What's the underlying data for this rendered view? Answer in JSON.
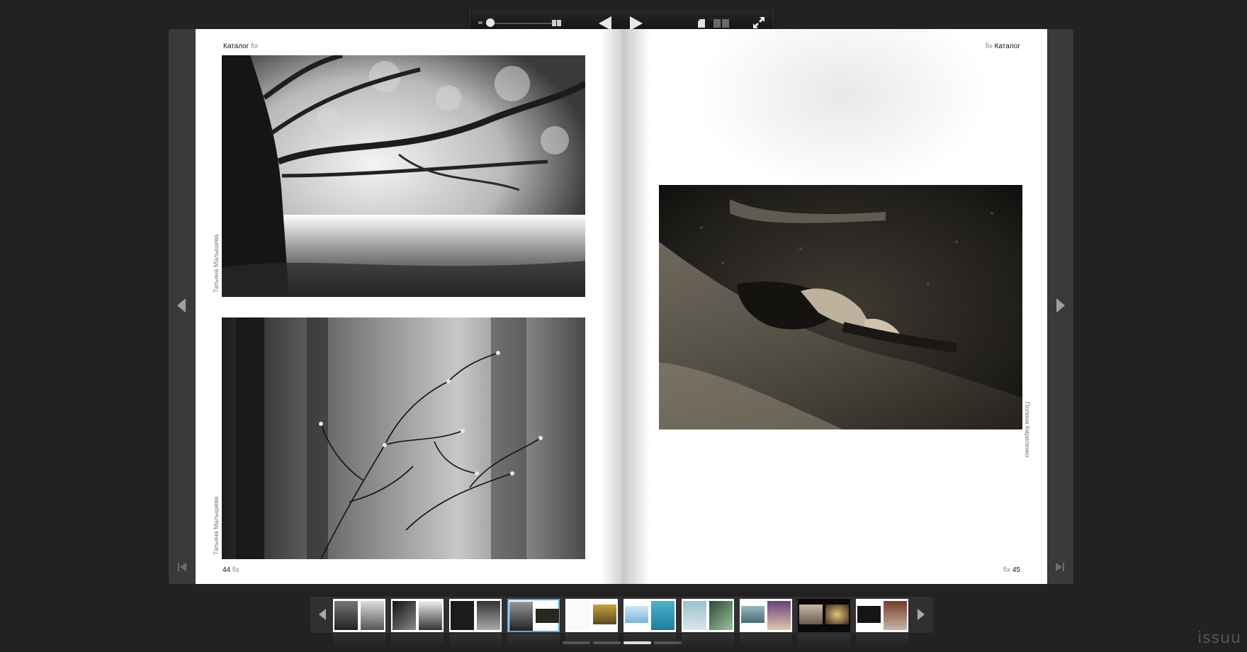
{
  "toolbar": {
    "controls": [
      "zoom-out",
      "zoom-slider",
      "zoom-in",
      "previous-page",
      "next-page",
      "single-page-view",
      "double-page-view",
      "fullscreen"
    ],
    "zoom_level": 0
  },
  "spread": {
    "left_page": {
      "header_title": "Каталог",
      "header_brand": "fix",
      "page_number": "44",
      "folio_brand": "fix",
      "photos": [
        {
          "description_icon": "forest-tree-photo",
          "credit": "Татьяна Малышева"
        },
        {
          "description_icon": "bare-branches-photo",
          "credit": "Татьяна Малышева"
        }
      ]
    },
    "right_page": {
      "header_title": "Каталог",
      "header_brand": "fix",
      "page_number": "45",
      "folio_brand": "fix",
      "photos": [
        {
          "description_icon": "woman-on-log-photo",
          "credit": "Полина Кириленко"
        }
      ]
    }
  },
  "thumbnails": {
    "count": 10,
    "active_index": 3
  },
  "pagination": {
    "dots": 4,
    "active_index": 2
  },
  "brand": "issuu"
}
